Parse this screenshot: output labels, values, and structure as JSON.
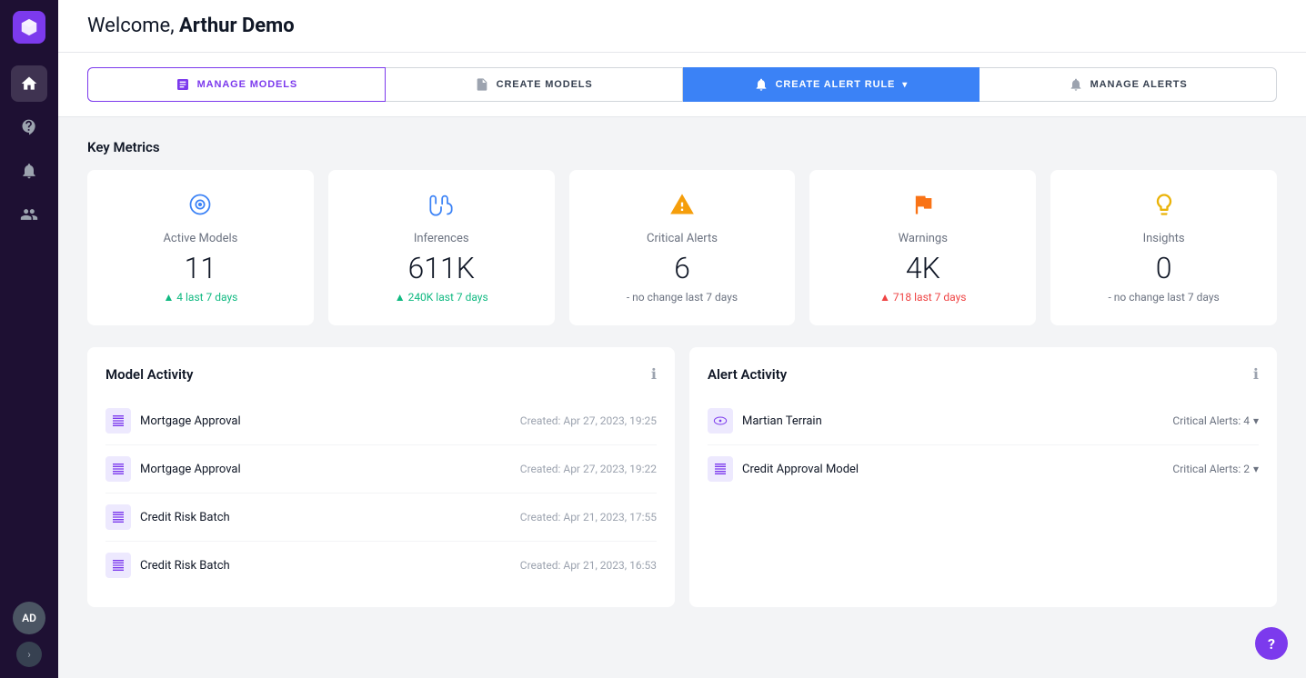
{
  "header": {
    "welcome_prefix": "Welcome, ",
    "username": "Arthur Demo"
  },
  "action_buttons": [
    {
      "id": "manage-models",
      "label": "MANAGE MODELS",
      "icon": "📋",
      "variant": "outline-purple"
    },
    {
      "id": "create-models",
      "label": "CREATE MODELS",
      "icon": "📄",
      "variant": "outline"
    },
    {
      "id": "create-alert-rule",
      "label": "CREATE ALERT RULE",
      "icon": "🔔",
      "variant": "primary"
    },
    {
      "id": "manage-alerts",
      "label": "MANAGE ALERTS",
      "icon": "🔔",
      "variant": "outline"
    }
  ],
  "key_metrics": {
    "title": "Key Metrics",
    "cards": [
      {
        "id": "active-models",
        "label": "Active Models",
        "value": "11",
        "change": "▲ 4 last 7 days",
        "change_type": "up",
        "icon": "🎯"
      },
      {
        "id": "inferences",
        "label": "Inferences",
        "value": "611K",
        "change": "▲ 240K last 7 days",
        "change_type": "up",
        "icon": "✋"
      },
      {
        "id": "critical-alerts",
        "label": "Critical Alerts",
        "value": "6",
        "change": "- no change last 7 days",
        "change_type": "neutral",
        "icon": "⚠️"
      },
      {
        "id": "warnings",
        "label": "Warnings",
        "value": "4K",
        "change": "▲ 718 last 7 days",
        "change_type": "up-warn",
        "icon": "🚩"
      },
      {
        "id": "insights",
        "label": "Insights",
        "value": "0",
        "change": "- no change last 7 days",
        "change_type": "neutral",
        "icon": "💡"
      }
    ]
  },
  "model_activity": {
    "title": "Model Activity",
    "items": [
      {
        "name": "Mortgage Approval",
        "date": "Created: Apr 27, 2023, 19:25",
        "icon_type": "table"
      },
      {
        "name": "Mortgage Approval",
        "date": "Created: Apr 27, 2023, 19:22",
        "icon_type": "table"
      },
      {
        "name": "Credit Risk Batch",
        "date": "Created: Apr 21, 2023, 17:55",
        "icon_type": "table"
      },
      {
        "name": "Credit Risk Batch",
        "date": "Created: Apr 21, 2023, 16:53",
        "icon_type": "table"
      }
    ]
  },
  "alert_activity": {
    "title": "Alert Activity",
    "items": [
      {
        "name": "Martian Terrain",
        "alerts": "Critical Alerts: 4",
        "icon_type": "eye"
      },
      {
        "name": "Credit Approval Model",
        "alerts": "Critical Alerts: 2",
        "icon_type": "table"
      }
    ]
  },
  "sidebar": {
    "items": [
      {
        "id": "home",
        "icon": "home",
        "active": true
      },
      {
        "id": "models",
        "icon": "star",
        "active": false
      },
      {
        "id": "alerts",
        "icon": "bell",
        "active": false
      },
      {
        "id": "analytics",
        "icon": "chart",
        "active": false
      }
    ],
    "avatar_initials": "AD"
  },
  "help_button_label": "?"
}
